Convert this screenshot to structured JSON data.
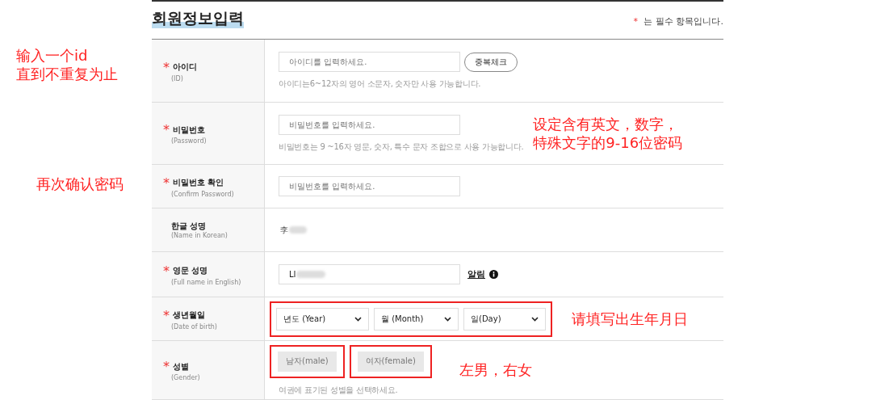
{
  "title": "회원정보입력",
  "required_note": {
    "mark": "*",
    "text": "는 필수 항목입니다."
  },
  "rows": [
    {
      "kind": "input_button",
      "required": true,
      "label": "아이디",
      "sublabel": "(ID)",
      "placeholder": "아이디를 입력하세요.",
      "button": "중복체크",
      "hint": "아이디는6~12자의 영어 소문자, 숫자만 사용 가능합니다.",
      "margin_note": [
        "输入一个id",
        "直到不重复为止"
      ]
    },
    {
      "kind": "input",
      "required": true,
      "label": "비밀번호",
      "sublabel": "(Password)",
      "placeholder": "비밀번호를 입력하세요.",
      "hint": "비밀번호는 9 ~16자 영문, 숫자, 특수 문자 조합으로 사용 가능합니다.",
      "annotation": [
        "设定含有英文，数字，",
        "特殊文字的9-16位密码"
      ]
    },
    {
      "kind": "input",
      "required": true,
      "label": "비밀번호 확인",
      "sublabel": "(Confirm Password)",
      "placeholder": "비밀번호를 입력하세요.",
      "margin_note": [
        "再次确认密码"
      ]
    },
    {
      "kind": "text",
      "required": false,
      "label": "한글 성명",
      "sublabel": "(Name in Korean)",
      "value": "李"
    },
    {
      "kind": "input_link",
      "required": true,
      "label": "영문 성명",
      "sublabel": "(Full name in English)",
      "value": "LI",
      "link": "알림"
    },
    {
      "kind": "selects",
      "required": true,
      "label": "생년월일",
      "sublabel": "(Date of birth)",
      "highlighted": true,
      "selects": [
        "년도 (Year)",
        "월 (Month)",
        "일(Day)"
      ],
      "annotation": [
        "请填写出生年月日"
      ]
    },
    {
      "kind": "toggle",
      "required": true,
      "label": "성별",
      "sublabel": "(Gender)",
      "options": [
        {
          "label": "남자(male)",
          "selected": false,
          "highlighted": true
        },
        {
          "label": "여자(female)",
          "selected": false,
          "highlighted": true
        }
      ],
      "hint": "여권에 표기된 성별을 선택하세요.",
      "annotation": [
        "左男，右女"
      ]
    }
  ]
}
